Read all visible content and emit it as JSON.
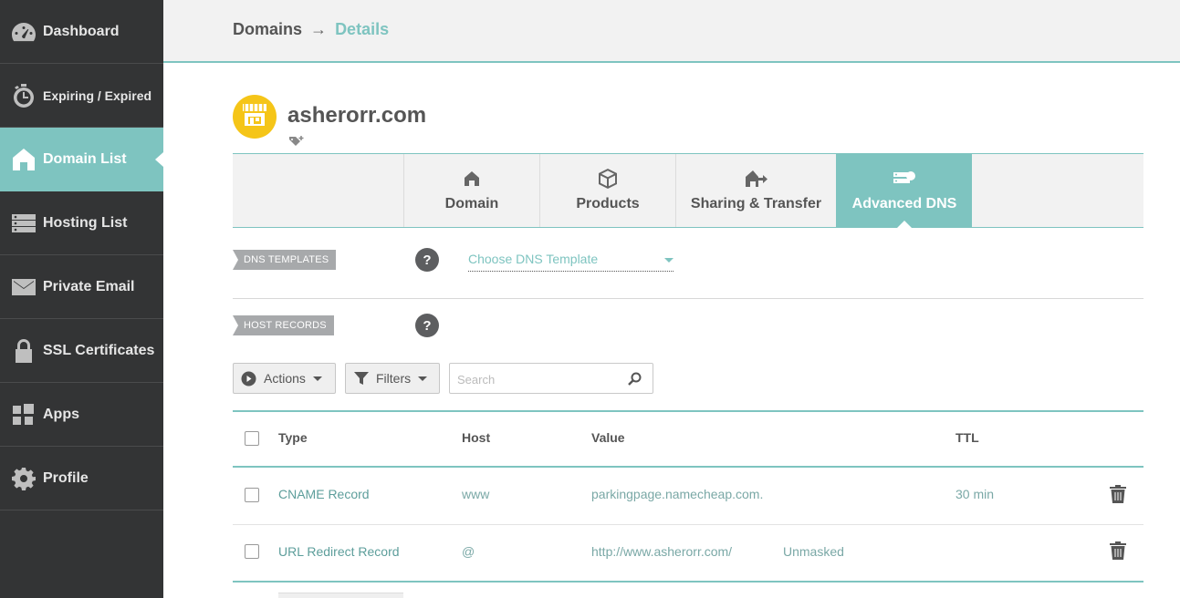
{
  "sidebar": {
    "items": [
      {
        "label": "Dashboard",
        "icon": "speedometer-icon"
      },
      {
        "label": "Expiring / Expired",
        "icon": "stopwatch-icon"
      },
      {
        "label": "Domain List",
        "icon": "home-icon",
        "active": true
      },
      {
        "label": "Hosting List",
        "icon": "server-icon"
      },
      {
        "label": "Private Email",
        "icon": "envelope-icon"
      },
      {
        "label": "SSL Certificates",
        "icon": "lock-icon"
      },
      {
        "label": "Apps",
        "icon": "apps-grid-icon"
      },
      {
        "label": "Profile",
        "icon": "gear-icon"
      }
    ]
  },
  "header": {
    "crumb_root": "Domains",
    "crumb_sep": "→",
    "crumb_current": "Details"
  },
  "domain": {
    "name": "asherorr.com",
    "avatar_color": "#f5c518"
  },
  "tabs": [
    {
      "label": "Domain",
      "icon": "home-icon"
    },
    {
      "label": "Products",
      "icon": "box-icon"
    },
    {
      "label": "Sharing & Transfer",
      "icon": "transfer-icon"
    },
    {
      "label": "Advanced DNS",
      "icon": "dns-server-icon",
      "active": true
    }
  ],
  "dns_templates": {
    "label": "DNS TEMPLATES",
    "help": "?",
    "select_value": "Choose DNS Template"
  },
  "host_records": {
    "label": "HOST RECORDS",
    "help": "?"
  },
  "toolbar": {
    "actions_label": "Actions",
    "filters_label": "Filters",
    "search_placeholder": "Search"
  },
  "table": {
    "columns": [
      "Type",
      "Host",
      "Value",
      "TTL"
    ],
    "rows": [
      {
        "type": "CNAME Record",
        "host": "www",
        "value": "parkingpage.namecheap.com.",
        "extra": "",
        "ttl": "30 min"
      },
      {
        "type": "URL Redirect Record",
        "host": "@",
        "value": "http://www.asherorr.com/",
        "extra": "Unmasked",
        "ttl": ""
      }
    ]
  },
  "colors": {
    "accent": "#7ec4c0",
    "sidebar_bg": "#333435",
    "label_gray": "#a7a9ab"
  }
}
